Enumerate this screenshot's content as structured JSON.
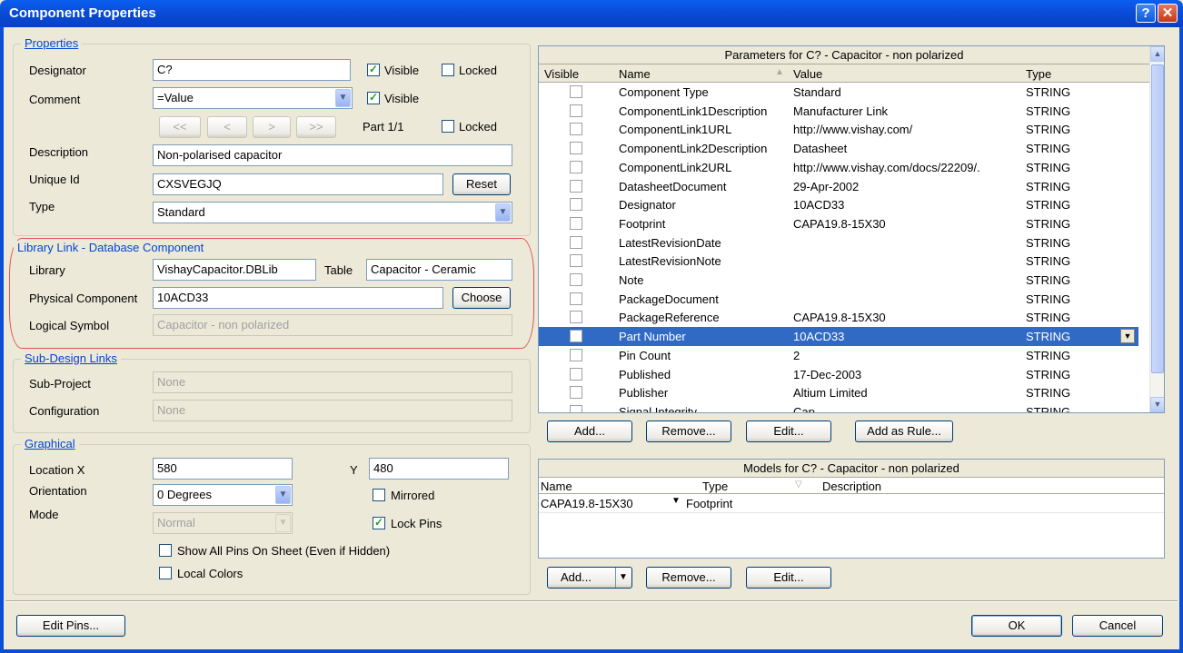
{
  "window": {
    "title": "Component Properties",
    "help": "?",
    "close": "✕"
  },
  "properties": {
    "legend": "Properties",
    "designator_label": "Designator",
    "designator_value": "C?",
    "visible_label": "Visible",
    "locked_label": "Locked",
    "comment_label": "Comment",
    "comment_value": "=Value",
    "comment_visible_label": "Visible",
    "nav": [
      "<<",
      "<",
      ">",
      ">>"
    ],
    "part_label": "Part 1/1",
    "part_locked_label": "Locked",
    "description_label": "Description",
    "description_value": "Non-polarised capacitor",
    "uniqueid_label": "Unique Id",
    "uniqueid_value": "CXSVEGJQ",
    "reset_label": "Reset",
    "type_label": "Type",
    "type_value": "Standard"
  },
  "library": {
    "legend": "Library Link - Database Component",
    "library_label": "Library",
    "library_value": "VishayCapacitor.DBLib",
    "table_label": "Table",
    "table_value": "Capacitor - Ceramic",
    "physical_label": "Physical Component",
    "physical_value": "10ACD33",
    "choose_label": "Choose",
    "logical_label": "Logical Symbol",
    "logical_value": "Capacitor - non polarized"
  },
  "subdesign": {
    "legend": "Sub-Design Links",
    "subproject_label": "Sub-Project",
    "subproject_value": "None",
    "config_label": "Configuration",
    "config_value": "None"
  },
  "graphical": {
    "legend": "Graphical",
    "locx_label": "Location X",
    "locx_value": "580",
    "y_label": "Y",
    "y_value": "480",
    "orientation_label": "Orientation",
    "orientation_value": "0 Degrees",
    "mirrored_label": "Mirrored",
    "mode_label": "Mode",
    "mode_value": "Normal",
    "lockpins_label": "Lock Pins",
    "showpins_label": "Show All Pins On Sheet (Even if Hidden)",
    "localcolors_label": "Local Colors"
  },
  "parameters": {
    "title": "Parameters for C? - Capacitor - non polarized",
    "headers": {
      "visible": "Visible",
      "name": "Name",
      "value": "Value",
      "type": "Type"
    },
    "rows": [
      {
        "name": "Component Type",
        "value": "Standard",
        "type": "STRING"
      },
      {
        "name": "ComponentLink1Description",
        "value": "Manufacturer Link",
        "type": "STRING"
      },
      {
        "name": "ComponentLink1URL",
        "value": "http://www.vishay.com/",
        "type": "STRING"
      },
      {
        "name": "ComponentLink2Description",
        "value": "Datasheet",
        "type": "STRING"
      },
      {
        "name": "ComponentLink2URL",
        "value": "http://www.vishay.com/docs/22209/.",
        "type": "STRING"
      },
      {
        "name": "DatasheetDocument",
        "value": "29-Apr-2002",
        "type": "STRING"
      },
      {
        "name": "Designator",
        "value": "10ACD33",
        "type": "STRING"
      },
      {
        "name": "Footprint",
        "value": "CAPA19.8-15X30",
        "type": "STRING"
      },
      {
        "name": "LatestRevisionDate",
        "value": "",
        "type": "STRING"
      },
      {
        "name": "LatestRevisionNote",
        "value": "",
        "type": "STRING"
      },
      {
        "name": "Note",
        "value": "",
        "type": "STRING"
      },
      {
        "name": "PackageDocument",
        "value": "",
        "type": "STRING"
      },
      {
        "name": "PackageReference",
        "value": "CAPA19.8-15X30",
        "type": "STRING"
      },
      {
        "name": "Part Number",
        "value": "10ACD33",
        "type": "STRING"
      },
      {
        "name": "Pin Count",
        "value": "2",
        "type": "STRING"
      },
      {
        "name": "Published",
        "value": "17-Dec-2003",
        "type": "STRING"
      },
      {
        "name": "Publisher",
        "value": "Altium Limited",
        "type": "STRING"
      },
      {
        "name": "Signal Integrity",
        "value": "Cap",
        "type": "STRING"
      }
    ],
    "selected_index": 13,
    "add_label": "Add...",
    "remove_label": "Remove...",
    "edit_label": "Edit...",
    "add_rule_label": "Add as Rule..."
  },
  "models": {
    "title": "Models for C? - Capacitor - non polarized",
    "headers": {
      "name": "Name",
      "type": "Type",
      "description": "Description"
    },
    "rows": [
      {
        "name": "CAPA19.8-15X30",
        "type": "Footprint",
        "description": ""
      }
    ],
    "add_label": "Add...",
    "remove_label": "Remove...",
    "edit_label": "Edit..."
  },
  "footer": {
    "edit_pins_label": "Edit Pins...",
    "ok_label": "OK",
    "cancel_label": "Cancel"
  }
}
